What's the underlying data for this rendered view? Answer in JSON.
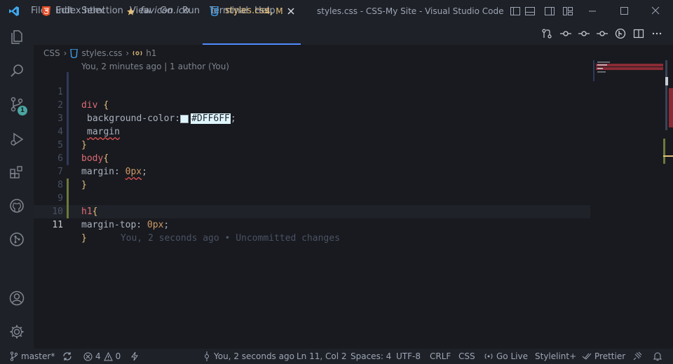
{
  "window": {
    "title": "styles.css - CSS-My Site - Visual Studio Code"
  },
  "menu": [
    {
      "label": "File"
    },
    {
      "label": "Edit"
    },
    {
      "label": "Selection"
    },
    {
      "label": "View"
    },
    {
      "label": "Go"
    },
    {
      "label": "Run"
    },
    {
      "label": "Terminal"
    },
    {
      "label": "Help"
    }
  ],
  "activity": {
    "source_control_badge": "1"
  },
  "tabs": [
    {
      "label": "index.html",
      "icon": "html5-icon"
    },
    {
      "label": "favicon.ico",
      "icon": "star-icon"
    },
    {
      "label": "styles.css",
      "icon": "css-icon",
      "status": "4, M",
      "active": true
    }
  ],
  "breadcrumb": {
    "folder": "CSS",
    "file": "styles.css",
    "symbol": "h1"
  },
  "codelens": "You, 2 minutes ago | 1 author (You)",
  "code": {
    "line_numbers": [
      "1",
      "2",
      "3",
      "4",
      "5",
      "6",
      "7",
      "8",
      "9",
      "10",
      "11"
    ],
    "l1": {
      "selector": "div",
      "brace": "{"
    },
    "l2": {
      "prop": "background-color:",
      "value": "#DFF6FF",
      "semi": ";"
    },
    "l3": {
      "prop": "margin"
    },
    "l4": {
      "brace": "}"
    },
    "l5": {
      "selector": "body",
      "brace": "{"
    },
    "l6": {
      "prop": "margin: ",
      "value": "0px",
      "semi": ";"
    },
    "l7": {
      "brace": "}"
    },
    "l9": {
      "selector": "h1",
      "brace": "{"
    },
    "l10": {
      "prop": "margin-top: ",
      "value": "0px",
      "semi": ";"
    },
    "l11": {
      "brace": "}",
      "blame": "You, 2 seconds ago • Uncommitted changes"
    }
  },
  "statusbar": {
    "branch": "master*",
    "errors": "4",
    "warnings": "0",
    "blame": "You, 2 seconds ago",
    "position": "Ln 11, Col 2",
    "spaces": "Spaces: 4",
    "encoding": "UTF-8",
    "eol": "CRLF",
    "language": "CSS",
    "golive": "Go Live",
    "stylelint": "Stylelint+",
    "prettier": "Prettier"
  },
  "colors": {
    "accent": "#528bff",
    "badge": "#4aa5a0",
    "error": "#e05252",
    "modified": "#e5c07b"
  }
}
